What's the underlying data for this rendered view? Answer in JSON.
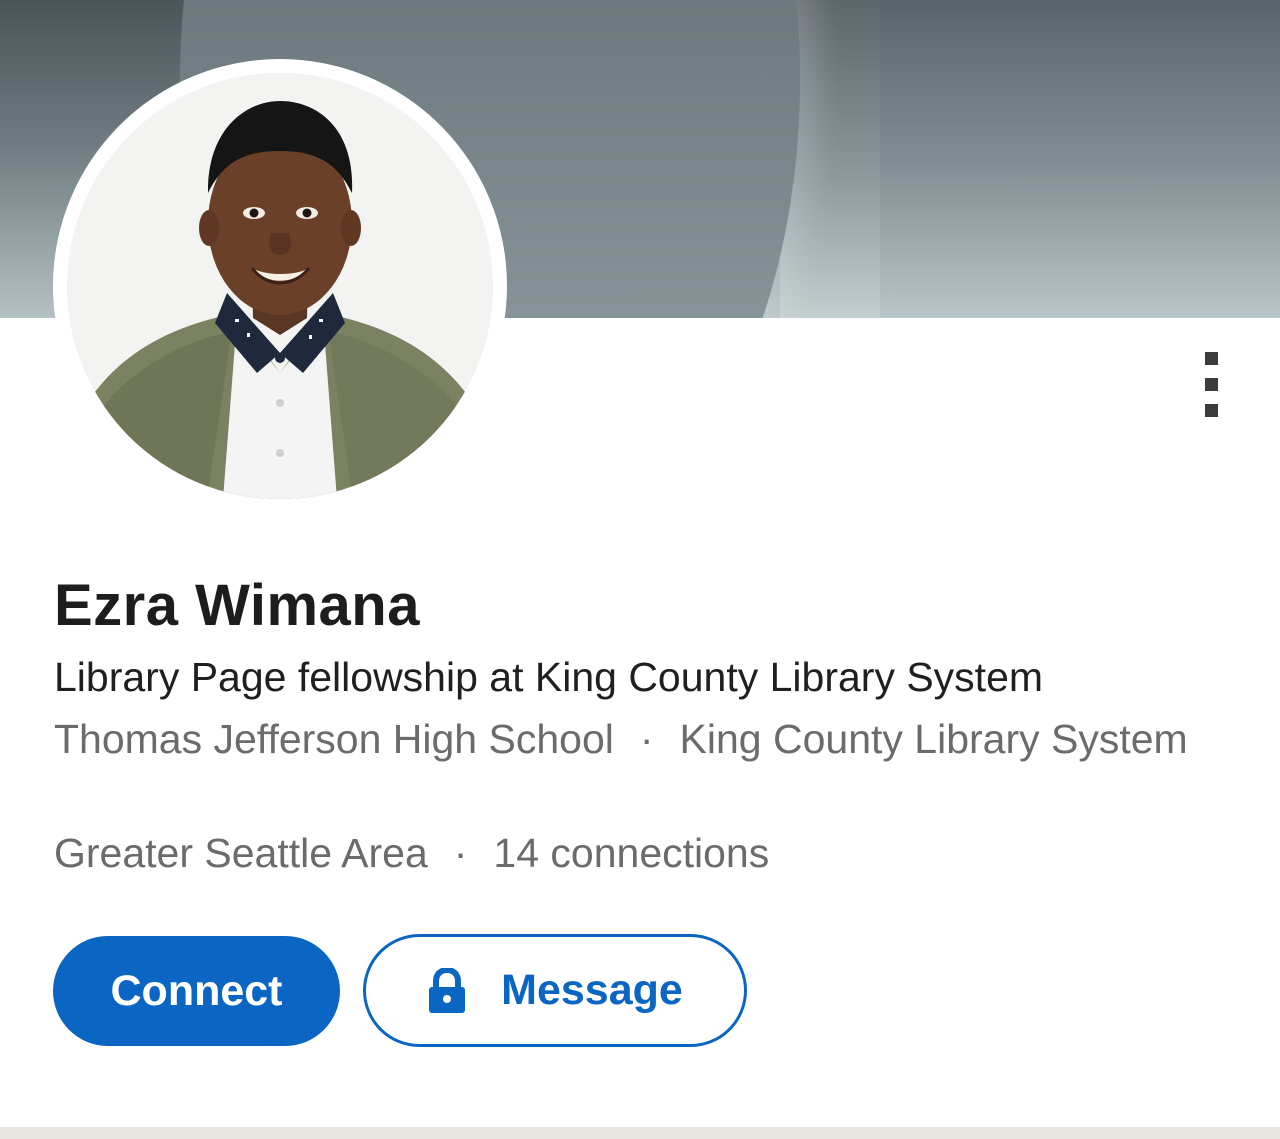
{
  "profile": {
    "name": "Ezra Wimana",
    "headline": "Library Page fellowship at King County Library System",
    "education": "Thomas Jefferson High School",
    "organization": "King County Library System",
    "location": "Greater Seattle Area",
    "connections": "14 connections",
    "separator": "·"
  },
  "actions": {
    "connect_label": "Connect",
    "message_label": "Message"
  },
  "icons": {
    "more": "more-vertical-icon",
    "lock": "lock-icon"
  },
  "colors": {
    "accent": "#0a66c2",
    "primary_text": "#1d1d1d",
    "secondary_text": "#6b6b6b"
  }
}
